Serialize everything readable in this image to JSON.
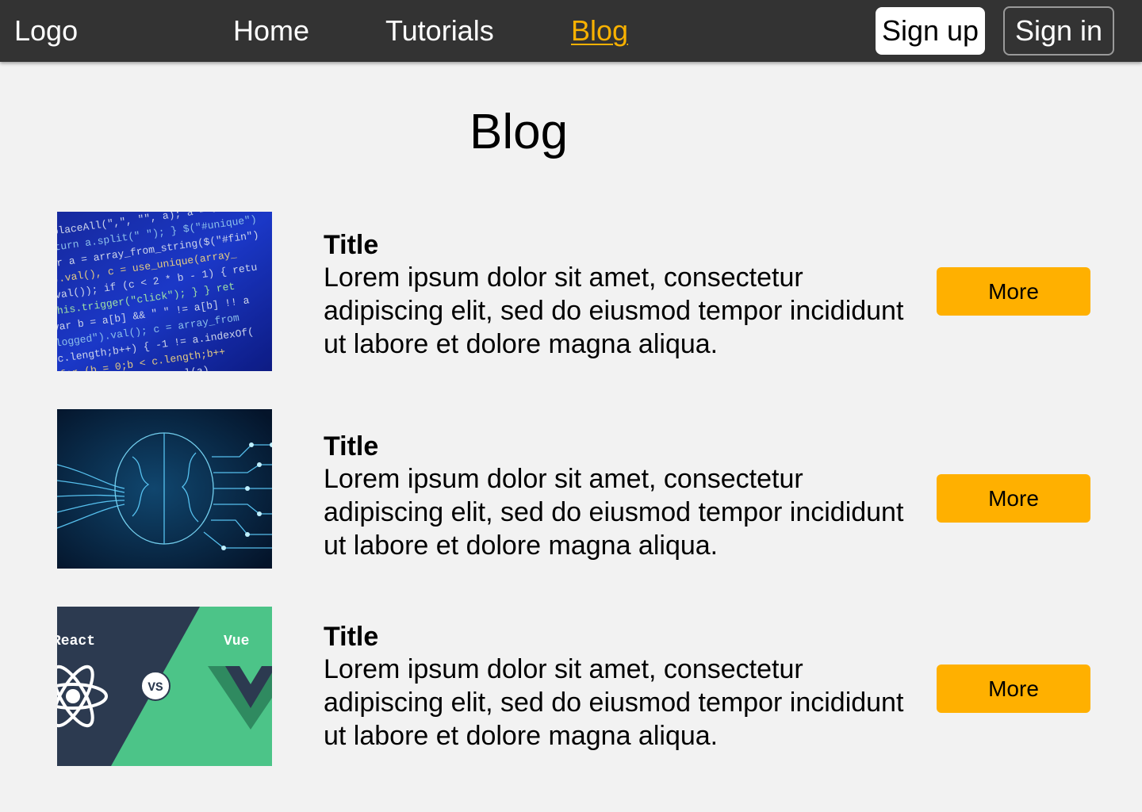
{
  "nav": {
    "logo": "Logo",
    "links": [
      "Home",
      "Tutorials",
      "Blog"
    ],
    "active": "Blog",
    "signup": "Sign up",
    "signin": "Sign in"
  },
  "page": {
    "title": "Blog"
  },
  "posts": [
    {
      "title": "Title",
      "body": "Lorem ipsum dolor sit amet, consectetur adipiscing elit, sed do eiusmod tempor incididunt ut labore et dolore magna aliqua.",
      "more": "More",
      "image": "code-screen-image"
    },
    {
      "title": "Title",
      "body": "Lorem ipsum dolor sit amet, consectetur adipiscing elit, sed do eiusmod tempor incididunt ut labore et dolore magna aliqua.",
      "more": "More",
      "image": "ai-brain-circuit-image"
    },
    {
      "title": "Title",
      "body": "Lorem ipsum dolor sit amet, consectetur adipiscing elit, sed do eiusmod tempor incididunt ut labore et dolore magna aliqua.",
      "more": "More",
      "image": "react-vs-vue-image",
      "image_text": {
        "left": "React",
        "vs": "VS",
        "right": "Vue"
      }
    }
  ],
  "colors": {
    "navbar": "#333333",
    "accent": "#ffb000",
    "background": "#f2f2f2"
  }
}
